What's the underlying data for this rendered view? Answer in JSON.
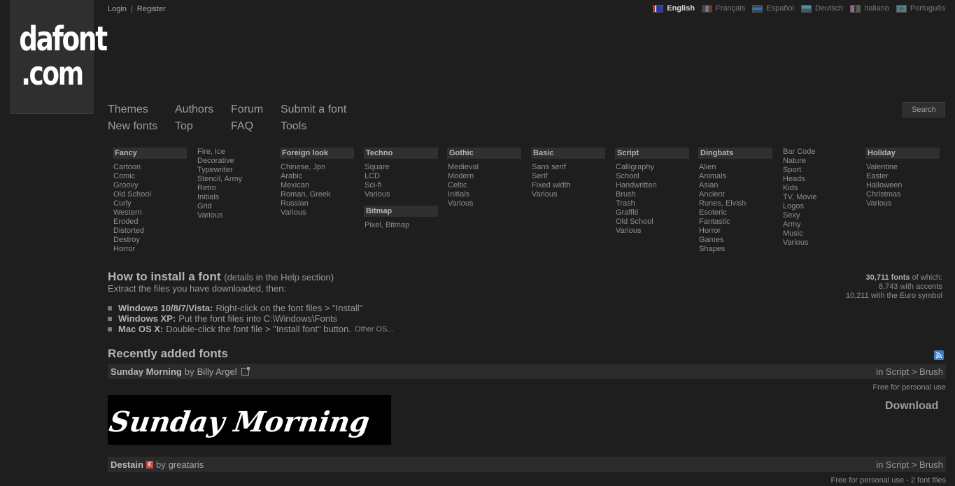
{
  "logo": {
    "line1": "dafont",
    "line2": ".com"
  },
  "user": {
    "login": "Login",
    "sep": "|",
    "register": "Register"
  },
  "languages": [
    {
      "label": "English",
      "active": true,
      "flag": "flag-uk"
    },
    {
      "label": "Français",
      "active": false,
      "flag": "flag-fr"
    },
    {
      "label": "Español",
      "active": false,
      "flag": "flag-es"
    },
    {
      "label": "Deutsch",
      "active": false,
      "flag": "flag-de"
    },
    {
      "label": "Italiano",
      "active": false,
      "flag": "flag-it"
    },
    {
      "label": "Português",
      "active": false,
      "flag": "flag-pt"
    }
  ],
  "nav": {
    "themes": "Themes",
    "new_fonts": "New fonts",
    "authors": "Authors",
    "top": "Top",
    "forum": "Forum",
    "faq": "FAQ",
    "submit": "Submit a font",
    "tools": "Tools",
    "search": "Search"
  },
  "categories": {
    "fancy": {
      "title": "Fancy",
      "items": [
        "Cartoon",
        "Comic",
        "Groovy",
        "Old School",
        "Curly",
        "Western",
        "Eroded",
        "Distorted",
        "Destroy",
        "Horror"
      ]
    },
    "fancy2": {
      "items": [
        "Fire, Ice",
        "Decorative",
        "Typewriter",
        "Stencil, Army",
        "Retro",
        "Initials",
        "Grid",
        "Various"
      ]
    },
    "foreign": {
      "title": "Foreign look",
      "items": [
        "Chinese, Jpn",
        "Arabic",
        "Mexican",
        "Roman, Greek",
        "Russian",
        "Various"
      ]
    },
    "techno": {
      "title": "Techno",
      "items": [
        "Square",
        "LCD",
        "Sci-fi",
        "Various"
      ]
    },
    "bitmap": {
      "title": "Bitmap",
      "items": [
        "Pixel, Bitmap"
      ]
    },
    "gothic": {
      "title": "Gothic",
      "items": [
        "Medieval",
        "Modern",
        "Celtic",
        "Initials",
        "Various"
      ]
    },
    "basic": {
      "title": "Basic",
      "items": [
        "Sans serif",
        "Serif",
        "Fixed width",
        "Various"
      ]
    },
    "script": {
      "title": "Script",
      "items": [
        "Calligraphy",
        "School",
        "Handwritten",
        "Brush",
        "Trash",
        "Graffiti",
        "Old School",
        "Various"
      ]
    },
    "dingbats": {
      "title": "Dingbats",
      "items": [
        "Alien",
        "Animals",
        "Asian",
        "Ancient",
        "Runes, Elvish",
        "Esoteric",
        "Fantastic",
        "Horror",
        "Games",
        "Shapes"
      ]
    },
    "dingbats2": {
      "items": [
        "Bar Code",
        "Nature",
        "Sport",
        "Heads",
        "Kids",
        "TV, Movie",
        "Logos",
        "Sexy",
        "Army",
        "Music",
        "Various"
      ]
    },
    "holiday": {
      "title": "Holiday",
      "items": [
        "Valentine",
        "Easter",
        "Halloween",
        "Christmas",
        "Various"
      ]
    }
  },
  "install": {
    "title": "How to install a font",
    "subtitle": "(details in the Help section)",
    "intro": "Extract the files you have downloaded, then:",
    "os": [
      {
        "name": "Windows 10/8/7/Vista:",
        "text": "Right-click on the font files > \"Install\""
      },
      {
        "name": "Windows XP:",
        "text": "Put the font files into C:\\Windows\\Fonts"
      },
      {
        "name": "Mac OS X:",
        "text": "Double-click the font file > \"Install font\" button.",
        "other": "Other OS..."
      }
    ]
  },
  "stats": {
    "count": "30,711 fonts",
    "of_which": "of which:",
    "accents": "8,743 with accents",
    "euro": "10,211 with the Euro symbol"
  },
  "recent": {
    "title": "Recently added fonts",
    "fonts": [
      {
        "name": "Sunday Morning",
        "by": "by",
        "author": "Billy Argel",
        "category": "in Script > Brush",
        "license": "Free for personal use",
        "preview": "Sunday Morning",
        "download": "Download"
      },
      {
        "name": "Destain",
        "by": "by",
        "author": "greataris",
        "category": "in Script > Brush",
        "license": "Free for personal use - 2 font files"
      }
    ]
  }
}
